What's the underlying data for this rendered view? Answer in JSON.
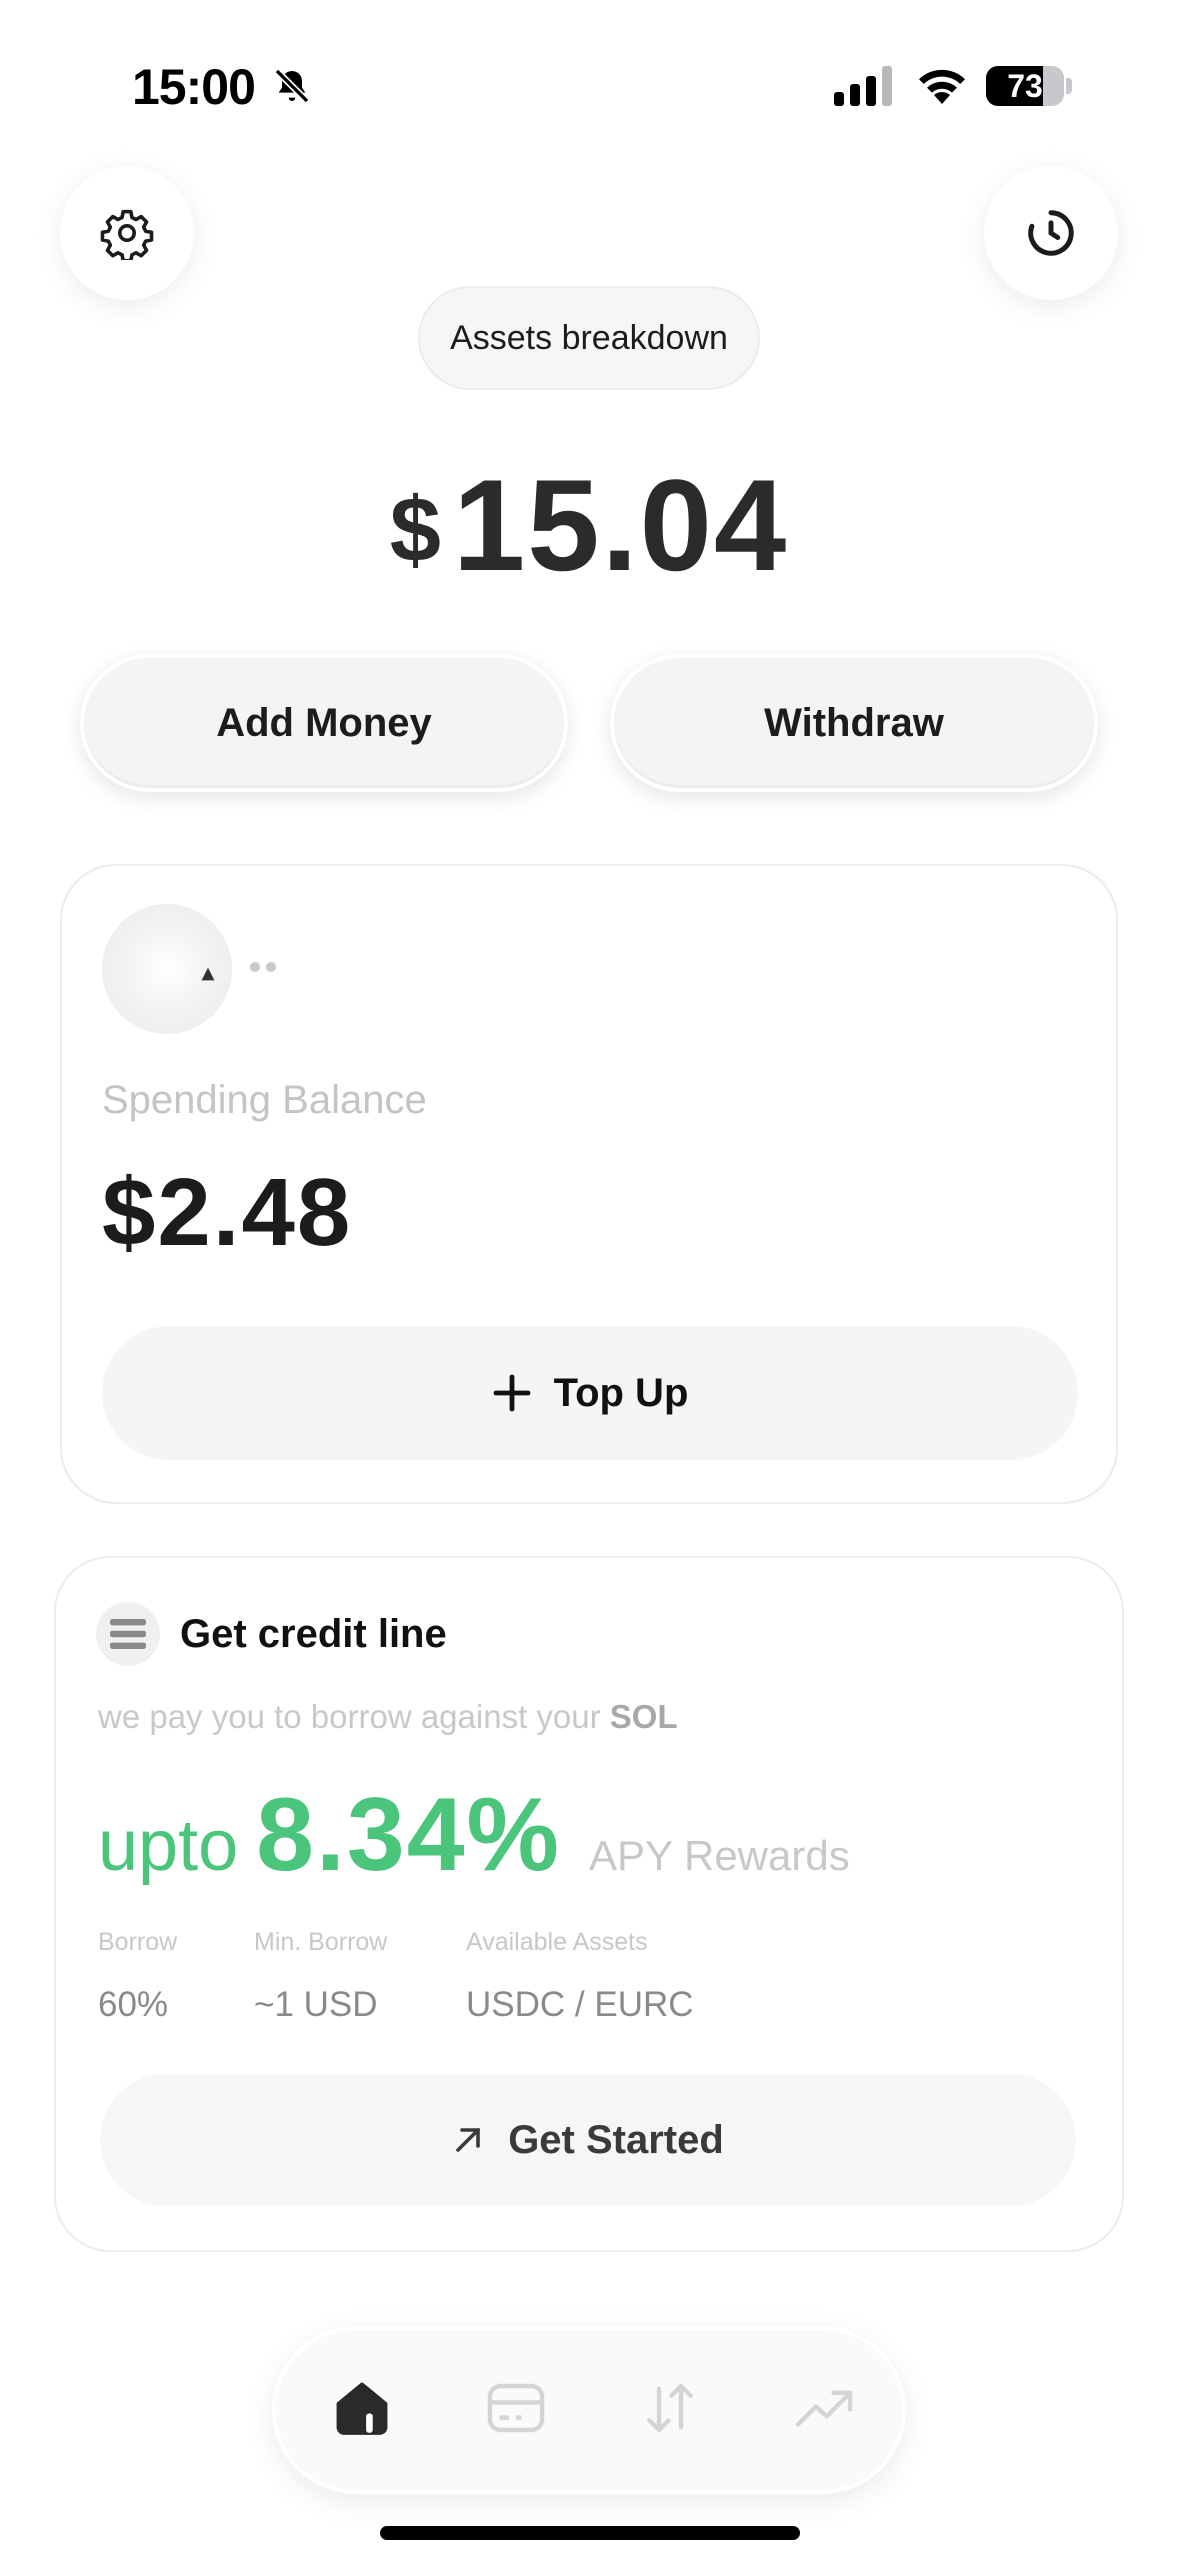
{
  "status_bar": {
    "time": "15:00",
    "battery_level": 73,
    "battery_text": "73",
    "icons": [
      "bell-slash-icon",
      "cellular-signal-icon",
      "wifi-icon",
      "battery-icon"
    ]
  },
  "header": {
    "settings_icon": "gear-icon",
    "history_icon": "clock-history-icon",
    "assets_breakdown_label": "Assets breakdown"
  },
  "balance": {
    "currency_symbol": "$",
    "amount": "15.04"
  },
  "actions": {
    "add_money_label": "Add Money",
    "withdraw_label": "Withdraw"
  },
  "spending_card": {
    "label": "Spending Balance",
    "amount": "$2.48",
    "top_up_label": "Top Up",
    "top_up_icon": "plus-icon"
  },
  "credit_card": {
    "icon": "stack-icon",
    "title": "Get credit line",
    "subtitle_prefix": "we pay you to borrow against your",
    "subtitle_asset": "SOL",
    "rate_prefix": "upto",
    "rate_value": "8.34%",
    "rate_suffix": "APY Rewards",
    "stats": [
      {
        "label": "Borrow",
        "value": "60%"
      },
      {
        "label": "Min. Borrow",
        "value": "~1 USD"
      },
      {
        "label": "Available Assets",
        "value": "USDC / EURC"
      }
    ],
    "get_started_label": "Get Started",
    "get_started_icon": "arrow-up-right-icon"
  },
  "bottom_nav": {
    "items": [
      {
        "name": "home",
        "icon": "home-icon",
        "active": true
      },
      {
        "name": "card",
        "icon": "card-icon",
        "active": false
      },
      {
        "name": "transfer",
        "icon": "transfer-arrows-icon",
        "active": false
      },
      {
        "name": "invest",
        "icon": "trending-up-icon",
        "active": false
      }
    ]
  },
  "colors": {
    "accent_green": "#4cc57c",
    "text_primary": "#1c1c1e",
    "muted": "#c8c8c8",
    "nav_active": "#2a2a2a",
    "nav_inactive": "#d4d4d4"
  }
}
